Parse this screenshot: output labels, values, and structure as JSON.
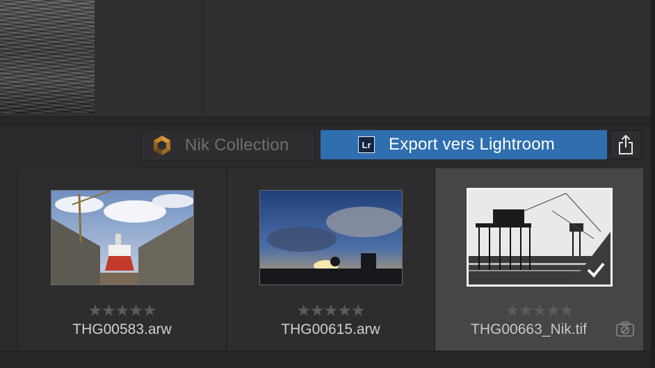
{
  "toolbar": {
    "nik_label": "Nik Collection",
    "export_label": "Export vers Lightroom",
    "export_icon_text": "Lr",
    "nik_icon": "nik-hexagon-icon",
    "share_icon": "share-icon",
    "accent": "#2f6fb0"
  },
  "filmstrip": {
    "items": [
      {
        "filename": "THG00583.arw",
        "stars": "★★★★★",
        "rating": 0,
        "selected": false
      },
      {
        "filename": "THG00615.arw",
        "stars": "★★★★★",
        "rating": 0,
        "selected": false
      },
      {
        "filename": "THG00663_Nik.tif",
        "stars": "★★★★★",
        "rating": 0,
        "selected": true,
        "badge_icon": "edited-checkmark-icon",
        "status_icon": "no-camera-icon"
      }
    ]
  }
}
